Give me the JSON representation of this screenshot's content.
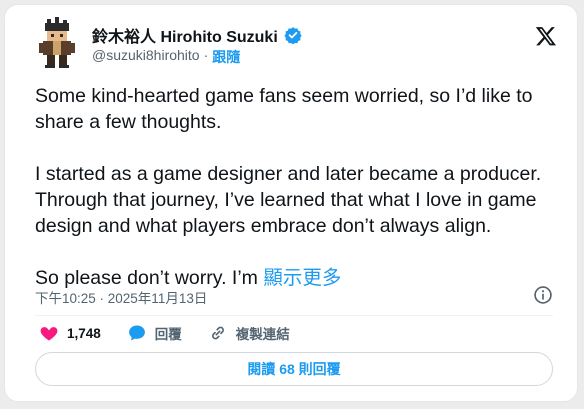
{
  "tweet": {
    "display_name": "鈴木裕人 Hirohito Suzuki",
    "handle": "@suzuki8hirohito",
    "separator": "·",
    "follow_label": "跟隨",
    "paragraphs": [
      "Some kind-hearted game fans seem worried, so I’d like to share a few thoughts.",
      "I started as a game designer and later became a producer. Through that journey, I’ve learned that what I love in game design and what players embrace don’t always align."
    ],
    "last_line": "So please don’t worry. I’m ",
    "show_more": "顯示更多",
    "timestamp": "下午10:25 · 2025年11月13日",
    "likes": "1,748",
    "reply_label": "回覆",
    "copy_link_label": "複製連結",
    "read_replies_label": "閱讀 68 則回覆"
  },
  "colors": {
    "accent": "#1d9bf0",
    "like": "#f91880",
    "text": "#0f1419",
    "muted": "#536471"
  },
  "icons": [
    "avatar",
    "verified-badge-icon",
    "x-logo-icon",
    "info-icon",
    "heart-icon",
    "reply-bubble-icon",
    "link-icon"
  ]
}
